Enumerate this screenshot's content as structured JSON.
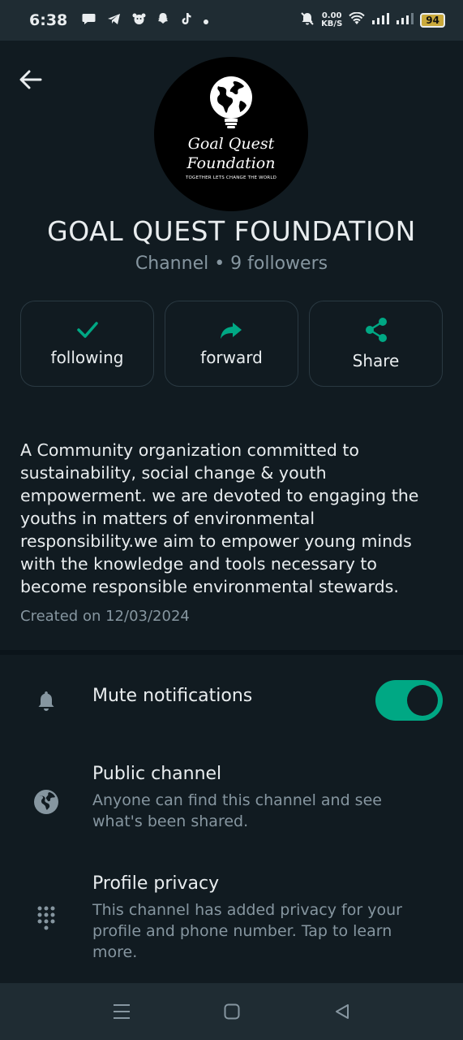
{
  "status_bar": {
    "time": "6:38",
    "net_speed_value": "0.00",
    "net_speed_unit": "KB/S",
    "battery": "94",
    "left_icons": [
      "chat-bubble-icon",
      "telegram-icon",
      "dog-icon",
      "snapchat-icon",
      "tiktok-icon",
      "dot-icon"
    ],
    "right_icons": [
      "mute-bell-icon",
      "wifi-icon",
      "signal-icon",
      "signal-icon-2",
      "battery-icon"
    ]
  },
  "header": {
    "back_icon": "arrow-left-icon",
    "logo": {
      "line1": "Goal Quest",
      "line2": "Foundation",
      "tagline": "TOGETHER LETS CHANGE THE WORLD"
    },
    "channel_name": "GOAL QUEST FOUNDATION",
    "channel_meta": "Channel • 9 followers"
  },
  "actions": [
    {
      "label": "following",
      "icon": "check-icon"
    },
    {
      "label": "forward",
      "icon": "forward-icon"
    },
    {
      "label": "Share",
      "icon": "share-icon"
    }
  ],
  "description": "A Community organization committed to sustainability, social change & youth empowerment. we are devoted to engaging the youths in matters of environmental responsibility.we aim to empower young minds with the knowledge and tools necessary to become responsible environmental stewards.",
  "created": "Created on 12/03/2024",
  "settings": {
    "mute": {
      "title": "Mute notifications",
      "icon": "bell-icon",
      "enabled": true
    },
    "public": {
      "title": "Public channel",
      "subtitle": "Anyone can find this channel and see what's been shared.",
      "icon": "globe-icon"
    },
    "privacy": {
      "title": "Profile privacy",
      "subtitle": "This channel has added privacy for your profile and phone number. Tap to learn more.",
      "icon": "dialpad-icon"
    }
  },
  "nav_bar": {
    "icons": [
      "menu-icon",
      "home-icon",
      "back-triangle-icon"
    ]
  },
  "colors": {
    "accent": "#00a884",
    "background": "#111b21",
    "text_secondary": "#8696a0"
  }
}
